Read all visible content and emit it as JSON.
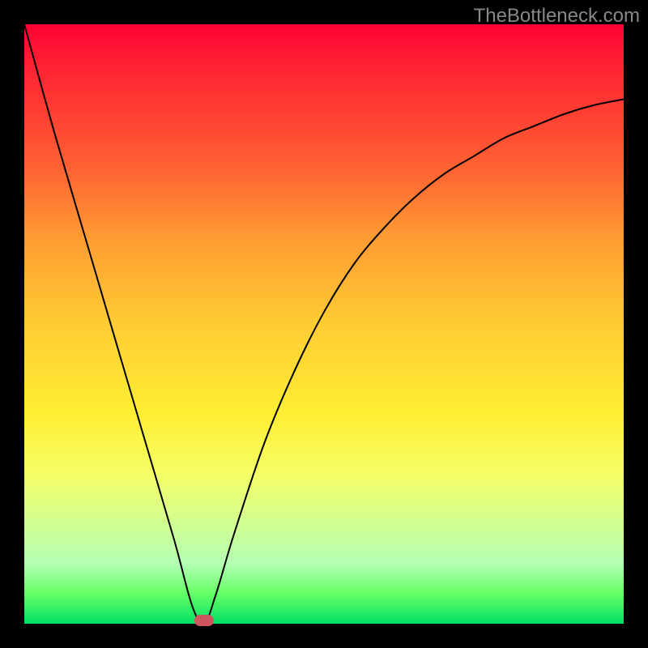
{
  "watermark": "TheBottleneck.com",
  "chart_data": {
    "type": "line",
    "title": "",
    "xlabel": "",
    "ylabel": "",
    "xlim": [
      0,
      100
    ],
    "ylim": [
      0,
      100
    ],
    "grid": false,
    "series": [
      {
        "name": "bottleneck-curve",
        "x": [
          0,
          5,
          10,
          15,
          20,
          25,
          28,
          30,
          32,
          35,
          40,
          45,
          50,
          55,
          60,
          65,
          70,
          75,
          80,
          85,
          90,
          95,
          100
        ],
        "values": [
          100,
          82,
          65,
          48,
          31,
          14,
          3,
          0,
          5,
          15,
          30,
          42,
          52,
          60,
          66,
          71,
          75,
          78,
          81,
          83,
          85,
          86.5,
          87.5
        ]
      }
    ],
    "marker": {
      "x": 30,
      "y": 0,
      "color": "#cc5560"
    },
    "background_gradient": [
      "#ff0033",
      "#ff9933",
      "#ffee33",
      "#00e066"
    ]
  }
}
